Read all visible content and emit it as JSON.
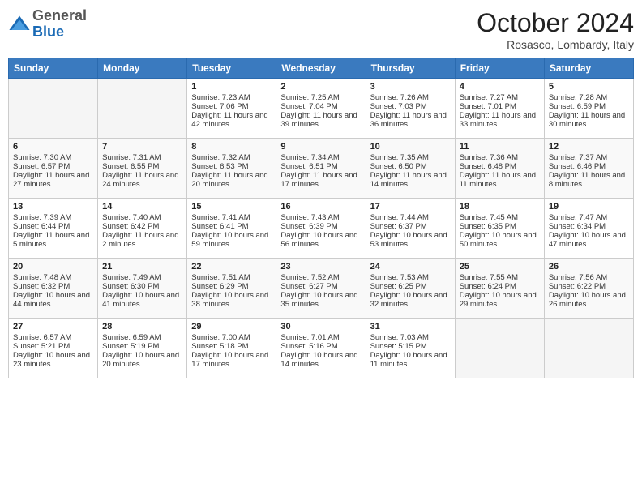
{
  "header": {
    "logo_general": "General",
    "logo_blue": "Blue",
    "title": "October 2024",
    "location": "Rosasco, Lombardy, Italy"
  },
  "days_of_week": [
    "Sunday",
    "Monday",
    "Tuesday",
    "Wednesday",
    "Thursday",
    "Friday",
    "Saturday"
  ],
  "weeks": [
    [
      {
        "day": "",
        "sunrise": "",
        "sunset": "",
        "daylight": ""
      },
      {
        "day": "",
        "sunrise": "",
        "sunset": "",
        "daylight": ""
      },
      {
        "day": "1",
        "sunrise": "Sunrise: 7:23 AM",
        "sunset": "Sunset: 7:06 PM",
        "daylight": "Daylight: 11 hours and 42 minutes."
      },
      {
        "day": "2",
        "sunrise": "Sunrise: 7:25 AM",
        "sunset": "Sunset: 7:04 PM",
        "daylight": "Daylight: 11 hours and 39 minutes."
      },
      {
        "day": "3",
        "sunrise": "Sunrise: 7:26 AM",
        "sunset": "Sunset: 7:03 PM",
        "daylight": "Daylight: 11 hours and 36 minutes."
      },
      {
        "day": "4",
        "sunrise": "Sunrise: 7:27 AM",
        "sunset": "Sunset: 7:01 PM",
        "daylight": "Daylight: 11 hours and 33 minutes."
      },
      {
        "day": "5",
        "sunrise": "Sunrise: 7:28 AM",
        "sunset": "Sunset: 6:59 PM",
        "daylight": "Daylight: 11 hours and 30 minutes."
      }
    ],
    [
      {
        "day": "6",
        "sunrise": "Sunrise: 7:30 AM",
        "sunset": "Sunset: 6:57 PM",
        "daylight": "Daylight: 11 hours and 27 minutes."
      },
      {
        "day": "7",
        "sunrise": "Sunrise: 7:31 AM",
        "sunset": "Sunset: 6:55 PM",
        "daylight": "Daylight: 11 hours and 24 minutes."
      },
      {
        "day": "8",
        "sunrise": "Sunrise: 7:32 AM",
        "sunset": "Sunset: 6:53 PM",
        "daylight": "Daylight: 11 hours and 20 minutes."
      },
      {
        "day": "9",
        "sunrise": "Sunrise: 7:34 AM",
        "sunset": "Sunset: 6:51 PM",
        "daylight": "Daylight: 11 hours and 17 minutes."
      },
      {
        "day": "10",
        "sunrise": "Sunrise: 7:35 AM",
        "sunset": "Sunset: 6:50 PM",
        "daylight": "Daylight: 11 hours and 14 minutes."
      },
      {
        "day": "11",
        "sunrise": "Sunrise: 7:36 AM",
        "sunset": "Sunset: 6:48 PM",
        "daylight": "Daylight: 11 hours and 11 minutes."
      },
      {
        "day": "12",
        "sunrise": "Sunrise: 7:37 AM",
        "sunset": "Sunset: 6:46 PM",
        "daylight": "Daylight: 11 hours and 8 minutes."
      }
    ],
    [
      {
        "day": "13",
        "sunrise": "Sunrise: 7:39 AM",
        "sunset": "Sunset: 6:44 PM",
        "daylight": "Daylight: 11 hours and 5 minutes."
      },
      {
        "day": "14",
        "sunrise": "Sunrise: 7:40 AM",
        "sunset": "Sunset: 6:42 PM",
        "daylight": "Daylight: 11 hours and 2 minutes."
      },
      {
        "day": "15",
        "sunrise": "Sunrise: 7:41 AM",
        "sunset": "Sunset: 6:41 PM",
        "daylight": "Daylight: 10 hours and 59 minutes."
      },
      {
        "day": "16",
        "sunrise": "Sunrise: 7:43 AM",
        "sunset": "Sunset: 6:39 PM",
        "daylight": "Daylight: 10 hours and 56 minutes."
      },
      {
        "day": "17",
        "sunrise": "Sunrise: 7:44 AM",
        "sunset": "Sunset: 6:37 PM",
        "daylight": "Daylight: 10 hours and 53 minutes."
      },
      {
        "day": "18",
        "sunrise": "Sunrise: 7:45 AM",
        "sunset": "Sunset: 6:35 PM",
        "daylight": "Daylight: 10 hours and 50 minutes."
      },
      {
        "day": "19",
        "sunrise": "Sunrise: 7:47 AM",
        "sunset": "Sunset: 6:34 PM",
        "daylight": "Daylight: 10 hours and 47 minutes."
      }
    ],
    [
      {
        "day": "20",
        "sunrise": "Sunrise: 7:48 AM",
        "sunset": "Sunset: 6:32 PM",
        "daylight": "Daylight: 10 hours and 44 minutes."
      },
      {
        "day": "21",
        "sunrise": "Sunrise: 7:49 AM",
        "sunset": "Sunset: 6:30 PM",
        "daylight": "Daylight: 10 hours and 41 minutes."
      },
      {
        "day": "22",
        "sunrise": "Sunrise: 7:51 AM",
        "sunset": "Sunset: 6:29 PM",
        "daylight": "Daylight: 10 hours and 38 minutes."
      },
      {
        "day": "23",
        "sunrise": "Sunrise: 7:52 AM",
        "sunset": "Sunset: 6:27 PM",
        "daylight": "Daylight: 10 hours and 35 minutes."
      },
      {
        "day": "24",
        "sunrise": "Sunrise: 7:53 AM",
        "sunset": "Sunset: 6:25 PM",
        "daylight": "Daylight: 10 hours and 32 minutes."
      },
      {
        "day": "25",
        "sunrise": "Sunrise: 7:55 AM",
        "sunset": "Sunset: 6:24 PM",
        "daylight": "Daylight: 10 hours and 29 minutes."
      },
      {
        "day": "26",
        "sunrise": "Sunrise: 7:56 AM",
        "sunset": "Sunset: 6:22 PM",
        "daylight": "Daylight: 10 hours and 26 minutes."
      }
    ],
    [
      {
        "day": "27",
        "sunrise": "Sunrise: 6:57 AM",
        "sunset": "Sunset: 5:21 PM",
        "daylight": "Daylight: 10 hours and 23 minutes."
      },
      {
        "day": "28",
        "sunrise": "Sunrise: 6:59 AM",
        "sunset": "Sunset: 5:19 PM",
        "daylight": "Daylight: 10 hours and 20 minutes."
      },
      {
        "day": "29",
        "sunrise": "Sunrise: 7:00 AM",
        "sunset": "Sunset: 5:18 PM",
        "daylight": "Daylight: 10 hours and 17 minutes."
      },
      {
        "day": "30",
        "sunrise": "Sunrise: 7:01 AM",
        "sunset": "Sunset: 5:16 PM",
        "daylight": "Daylight: 10 hours and 14 minutes."
      },
      {
        "day": "31",
        "sunrise": "Sunrise: 7:03 AM",
        "sunset": "Sunset: 5:15 PM",
        "daylight": "Daylight: 10 hours and 11 minutes."
      },
      {
        "day": "",
        "sunrise": "",
        "sunset": "",
        "daylight": ""
      },
      {
        "day": "",
        "sunrise": "",
        "sunset": "",
        "daylight": ""
      }
    ]
  ]
}
